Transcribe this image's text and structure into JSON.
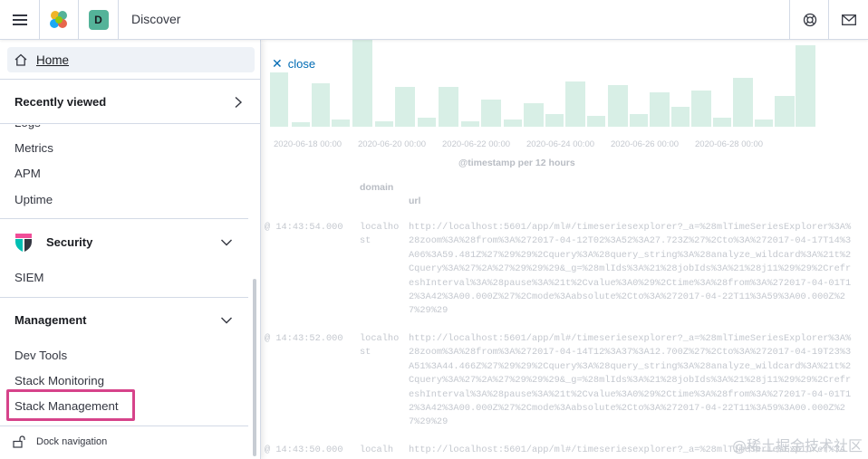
{
  "header": {
    "menu_icon": "hamburger-icon",
    "logo_icon": "elastic-logo",
    "space_initial": "D",
    "title": "Discover",
    "help_icon": "help-lifebuoy-icon",
    "mail_icon": "mail-icon"
  },
  "nav": {
    "home_label": "Home",
    "recently_viewed_title": "Recently viewed",
    "observability_items": [
      {
        "label": "Logs"
      },
      {
        "label": "Metrics"
      },
      {
        "label": "APM"
      },
      {
        "label": "Uptime"
      }
    ],
    "security_title": "Security",
    "security_items": [
      {
        "label": "SIEM"
      }
    ],
    "management_title": "Management",
    "management_items": [
      {
        "label": "Dev Tools"
      },
      {
        "label": "Stack Monitoring"
      },
      {
        "label": "Stack Management"
      }
    ],
    "dock_label": "Dock navigation",
    "highlight_color": "#d6438a"
  },
  "main": {
    "close_label": "close",
    "ticks": [
      "2020-06-18 00:00",
      "2020-06-20 00:00",
      "2020-06-22 00:00",
      "2020-06-24 00:00",
      "2020-06-26 00:00",
      "2020-06-28 00:00"
    ],
    "x_axis_label": "@timestamp per 12 hours",
    "columns": {
      "domain": "domain",
      "url": "url"
    },
    "docs": [
      {
        "time": "@ 14:43:54.000",
        "domain": "localhost",
        "url": "http://localhost:5601/app/ml#/timeseriesexplorer?_a=%28mlTimeSeriesExplorer%3A%28zoom%3A%28from%3A%272017-04-12T02%3A52%3A27.723Z%27%2Cto%3A%272017-04-17T14%3A06%3A59.481Z%27%29%29%2Cquery%3A%28query_string%3A%28analyze_wildcard%3A%21t%2Cquery%3A%27%2A%27%29%29%29&_g=%28mlIds%3A%21%28jobIds%3A%21%28j11%29%29%2CrefreshInterval%3A%28pause%3A%21t%2Cvalue%3A0%29%2Ctime%3A%28from%3A%272017-04-01T12%3A42%3A00.000Z%27%2Cmode%3Aabsolute%2Cto%3A%272017-04-22T11%3A59%3A00.000Z%27%29%29"
      },
      {
        "time": "@ 14:43:52.000",
        "domain": "localhost",
        "url": "http://localhost:5601/app/ml#/timeseriesexplorer?_a=%28mlTimeSeriesExplorer%3A%28zoom%3A%28from%3A%272017-04-14T12%3A37%3A12.700Z%27%2Cto%3A%272017-04-19T23%3A51%3A44.466Z%27%29%29%2Cquery%3A%28query_string%3A%28analyze_wildcard%3A%21t%2Cquery%3A%27%2A%27%29%29%29&_g=%28mlIds%3A%21%28jobIds%3A%21%28j11%29%29%2CrefreshInterval%3A%28pause%3A%21t%2Cvalue%3A0%29%2Ctime%3A%28from%3A%272017-04-01T12%3A42%3A00.000Z%27%2Cmode%3Aabsolute%2Cto%3A%272017-04-22T11%3A59%3A00.000Z%27%29%29"
      },
      {
        "time": "@ 14:43:50.000",
        "domain": "localh",
        "url": "http://localhost:5601/app/ml#/timeseriesexplorer?_a=%28mlTimeSeriesExplorer%3A"
      }
    ],
    "watermark": "@稀土掘金技术社区"
  }
}
